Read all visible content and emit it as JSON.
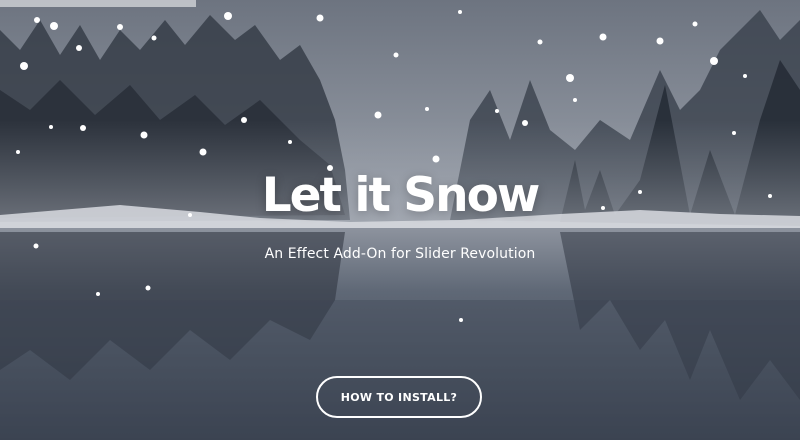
{
  "hero": {
    "title": "Let it Snow",
    "subtitle": "An Effect Add-On for Slider Revolution",
    "button_label": "HOW TO INSTALL?"
  },
  "colors": {
    "text": "#ffffff",
    "sky": "#7d8490",
    "water": "#505967",
    "trees": "#2b313b"
  },
  "background": {
    "description_icon": "snowy-forest-lake-image"
  }
}
